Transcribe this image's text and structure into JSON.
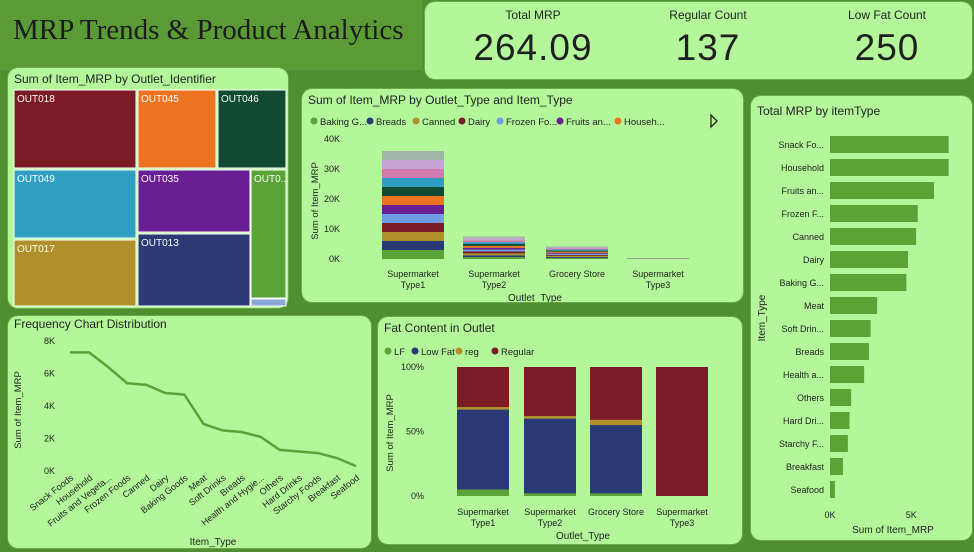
{
  "page_title": "MRP Trends & Product Analytics",
  "kpis": [
    {
      "label": "Total MRP",
      "value": "264.09"
    },
    {
      "label": "Regular Count",
      "value": "137"
    },
    {
      "label": "Low Fat Count",
      "value": "250"
    }
  ],
  "colors": {
    "green": "#5aa337",
    "navy": "#2a3a75",
    "maroon": "#7a1b25",
    "mustard": "#b0902a",
    "card": "#b3f79a"
  },
  "treemap": {
    "title": "Sum of Item_MRP by Outlet_Identifier",
    "tiles": [
      {
        "label": "OUT018",
        "color": "#7a1b25"
      },
      {
        "label": "OUT045",
        "color": "#ec7320"
      },
      {
        "label": "OUT046",
        "color": "#114a33"
      },
      {
        "label": "OUT049",
        "color": "#2f9ec2"
      },
      {
        "label": "OUT035",
        "color": "#6a1e93"
      },
      {
        "label": "OUT0...",
        "color": "#5aa337"
      },
      {
        "label": "OUT017",
        "color": "#b0902a"
      },
      {
        "label": "OUT013",
        "color": "#2a3a75"
      },
      {
        "label": "",
        "color": "#8aa8d8"
      }
    ]
  },
  "stacked_chart": {
    "title": "Sum of Item_MRP by Outlet_Type and Item_Type",
    "legend": [
      {
        "name": "Baking G...",
        "color": "#5aa337"
      },
      {
        "name": "Breads",
        "color": "#2a3a75"
      },
      {
        "name": "Canned",
        "color": "#b0902a"
      },
      {
        "name": "Dairy",
        "color": "#7a1b25"
      },
      {
        "name": "Frozen Fo...",
        "color": "#6f9ee6"
      },
      {
        "name": "Fruits an...",
        "color": "#6a1e93"
      },
      {
        "name": "Househ...",
        "color": "#ec7320"
      }
    ],
    "extra_segment_colors": [
      "#114a33",
      "#2f9ec2",
      "#d07ab0",
      "#c6a2d6",
      "#a2b6a8"
    ],
    "chart_data": {
      "type": "bar",
      "categories": [
        "Supermarket Type1",
        "Supermarket Type2",
        "Grocery Store",
        "Supermarket Type3"
      ],
      "totals": [
        36000,
        7500,
        4200,
        300
      ],
      "ylim": [
        0,
        40000
      ],
      "yticks": [
        "40K",
        "30K",
        "20K",
        "10K",
        "0K"
      ],
      "xlabel": "Outlet_Type",
      "ylabel": "Sum of Item_MRP"
    }
  },
  "bar_chart": {
    "title": "Total MRP by itemType",
    "chart_data": {
      "type": "bar",
      "categories": [
        "Snack Fo...",
        "Household",
        "Fruits an...",
        "Frozen F...",
        "Canned",
        "Dairy",
        "Baking G...",
        "Meat",
        "Soft Drin...",
        "Breads",
        "Health a...",
        "Others",
        "Hard Dri...",
        "Starchy F...",
        "Breakfast",
        "Seafood"
      ],
      "values": [
        7300,
        7300,
        6400,
        5400,
        5300,
        4800,
        4700,
        2900,
        2500,
        2400,
        2100,
        1300,
        1200,
        1100,
        800,
        300
      ],
      "xticks": [
        "0K",
        "5K"
      ],
      "xlim": [
        0,
        8000
      ],
      "xlabel": "Sum of Item_MRP",
      "ylabel": "Item_Type"
    }
  },
  "line_chart": {
    "title": "Frequency Chart Distribution",
    "chart_data": {
      "type": "line",
      "x": [
        "Snack Foods",
        "Household",
        "Fruits and Vegeta...",
        "Frozen Foods",
        "Canned",
        "Dairy",
        "Baking Goods",
        "Meat",
        "Soft Drinks",
        "Breads",
        "Health and Hygie...",
        "Others",
        "Hard Drinks",
        "Starchy Foods",
        "Breakfast",
        "Seafood"
      ],
      "values": [
        7300,
        7300,
        6400,
        5400,
        5300,
        4800,
        4700,
        2900,
        2500,
        2400,
        2100,
        1300,
        1200,
        1100,
        800,
        300
      ],
      "ylim": [
        0,
        8000
      ],
      "yticks": [
        "8K",
        "6K",
        "4K",
        "2K",
        "0K"
      ],
      "xlabel": "Item_Type",
      "ylabel": "Sum of Item_MRP"
    }
  },
  "fat_chart": {
    "title": "Fat Content in Outlet",
    "legend": [
      {
        "name": "LF",
        "color": "#5aa337"
      },
      {
        "name": "Low Fat",
        "color": "#2a3a75"
      },
      {
        "name": "reg",
        "color": "#b0902a"
      },
      {
        "name": "Regular",
        "color": "#7a1b25"
      }
    ],
    "chart_data": {
      "type": "bar",
      "categories": [
        "Supermarket Type1",
        "Supermarket Type2",
        "Grocery Store",
        "Supermarket Type3"
      ],
      "series": [
        {
          "name": "LF",
          "values": [
            5,
            2,
            2,
            0
          ]
        },
        {
          "name": "Low Fat",
          "values": [
            62,
            58,
            53,
            0
          ]
        },
        {
          "name": "reg",
          "values": [
            2,
            2,
            4,
            0
          ]
        },
        {
          "name": "Regular",
          "values": [
            31,
            38,
            41,
            100
          ]
        }
      ],
      "yticks": [
        "100%",
        "50%",
        "0%"
      ],
      "xlabel": "Outlet_Type",
      "ylabel": "Sum of Item_MRP"
    }
  }
}
